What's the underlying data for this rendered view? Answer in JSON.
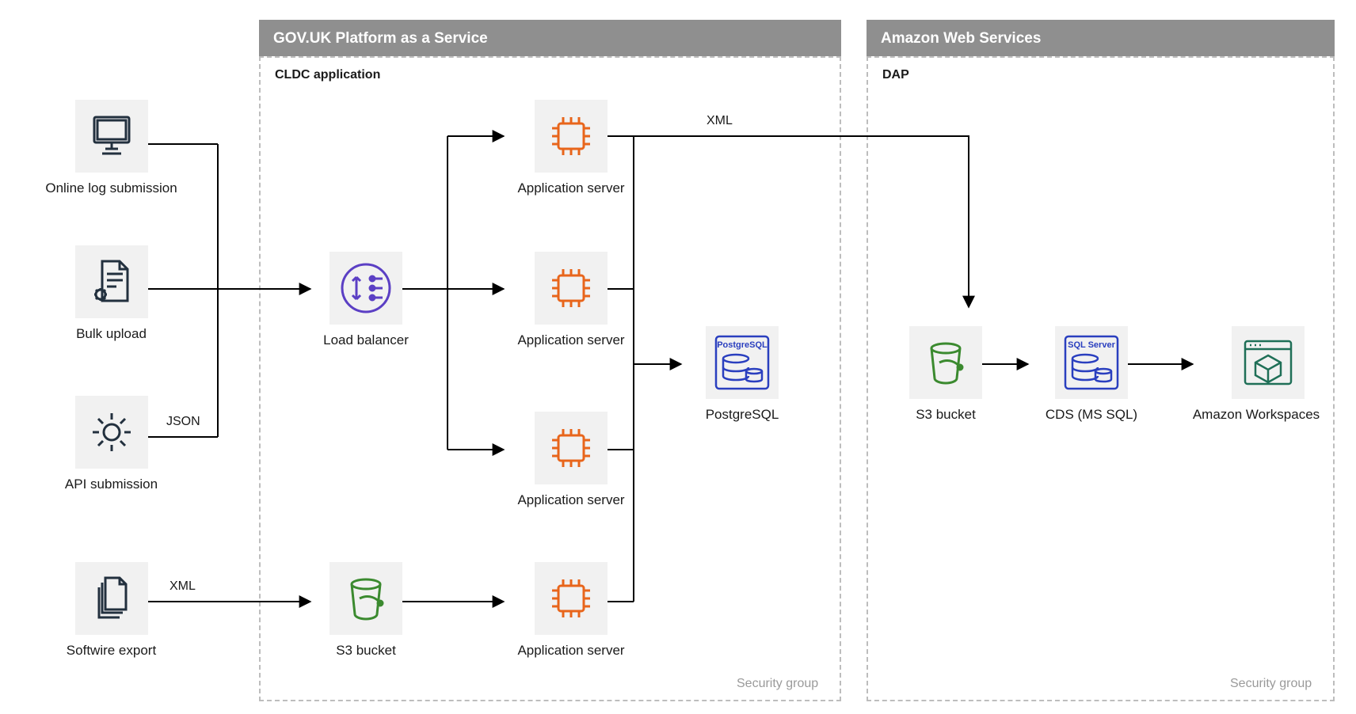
{
  "regions": {
    "paas": {
      "title": "GOV.UK Platform as a Service",
      "subtitle": "CLDC application",
      "security_label": "Security group"
    },
    "aws": {
      "title": "Amazon Web Services",
      "subtitle": "DAP",
      "security_label": "Security group"
    }
  },
  "nodes": {
    "online_log": {
      "label": "Online log submission"
    },
    "bulk_upload": {
      "label": "Bulk upload"
    },
    "api_submission": {
      "label": "API submission"
    },
    "softwire_export": {
      "label": "Softwire export"
    },
    "load_balancer": {
      "label": "Load balancer"
    },
    "s3_paas": {
      "label": "S3 bucket"
    },
    "app1": {
      "label": "Application server"
    },
    "app2": {
      "label": "Application server"
    },
    "app3": {
      "label": "Application server"
    },
    "app4": {
      "label": "Application server"
    },
    "postgres": {
      "label": "PostgreSQL",
      "badge": "PostgreSQL"
    },
    "s3_aws": {
      "label": "S3 bucket"
    },
    "cds": {
      "label": "CDS (MS SQL)",
      "badge": "SQL Server"
    },
    "workspaces": {
      "label": "Amazon Workspaces"
    }
  },
  "edges": {
    "json": "JSON",
    "xml1": "XML",
    "xml2": "XML"
  }
}
